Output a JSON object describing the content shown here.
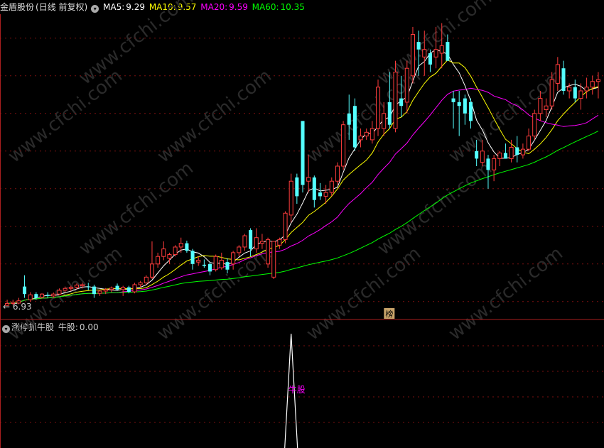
{
  "header": {
    "stock_name": "金盾股份",
    "period": "(日线 前复权)",
    "ma": [
      {
        "label": "MA5:",
        "value": "9.29",
        "color": "#ffffff"
      },
      {
        "label": "MA10:",
        "value": "9.57",
        "color": "#ffff00"
      },
      {
        "label": "MA20:",
        "value": "9.59",
        "color": "#ff00ff"
      },
      {
        "label": "MA60:",
        "value": "10.35",
        "color": "#00ff00"
      }
    ]
  },
  "indicator": {
    "name": "涨停抓牛股",
    "field_label": "牛股:",
    "field_value": "0.00",
    "marker_text": "牛股",
    "marker_color": "#ff00ff"
  },
  "price_annotation": "← 6.93",
  "rank_badge": "榜",
  "watermark": "www.cfchi.com",
  "chart_data": {
    "type": "candlestick",
    "ylim": [
      6.6,
      14.6
    ],
    "colors": {
      "up": "#ff3c3c",
      "down": "#54ffff"
    },
    "candles": [
      {
        "o": 6.9,
        "h": 7.05,
        "l": 6.88,
        "c": 6.95
      },
      {
        "o": 6.95,
        "h": 7.05,
        "l": 6.9,
        "c": 6.98
      },
      {
        "o": 6.96,
        "h": 7.1,
        "l": 6.93,
        "c": 7.02
      },
      {
        "o": 7.4,
        "h": 7.7,
        "l": 7.1,
        "c": 7.2
      },
      {
        "o": 7.05,
        "h": 7.25,
        "l": 7.0,
        "c": 7.18
      },
      {
        "o": 7.2,
        "h": 7.25,
        "l": 7.05,
        "c": 7.1
      },
      {
        "o": 7.12,
        "h": 7.22,
        "l": 7.08,
        "c": 7.2
      },
      {
        "o": 7.18,
        "h": 7.25,
        "l": 7.1,
        "c": 7.15
      },
      {
        "o": 7.15,
        "h": 7.24,
        "l": 7.1,
        "c": 7.2
      },
      {
        "o": 7.2,
        "h": 7.35,
        "l": 7.18,
        "c": 7.3
      },
      {
        "o": 7.3,
        "h": 7.4,
        "l": 7.25,
        "c": 7.35
      },
      {
        "o": 7.35,
        "h": 7.42,
        "l": 7.28,
        "c": 7.38
      },
      {
        "o": 7.38,
        "h": 7.48,
        "l": 7.33,
        "c": 7.44
      },
      {
        "o": 7.42,
        "h": 7.5,
        "l": 7.35,
        "c": 7.45
      },
      {
        "o": 7.4,
        "h": 7.5,
        "l": 7.3,
        "c": 7.38
      },
      {
        "o": 7.4,
        "h": 7.45,
        "l": 7.1,
        "c": 7.2
      },
      {
        "o": 7.22,
        "h": 7.32,
        "l": 7.15,
        "c": 7.28
      },
      {
        "o": 7.28,
        "h": 7.36,
        "l": 7.2,
        "c": 7.32
      },
      {
        "o": 7.32,
        "h": 7.4,
        "l": 7.25,
        "c": 7.36
      },
      {
        "o": 7.42,
        "h": 7.48,
        "l": 7.3,
        "c": 7.32
      },
      {
        "o": 7.32,
        "h": 7.42,
        "l": 7.15,
        "c": 7.38
      },
      {
        "o": 7.38,
        "h": 7.42,
        "l": 7.22,
        "c": 7.26
      },
      {
        "o": 7.26,
        "h": 7.5,
        "l": 7.22,
        "c": 7.45
      },
      {
        "o": 7.45,
        "h": 7.55,
        "l": 7.38,
        "c": 7.5
      },
      {
        "o": 7.5,
        "h": 7.7,
        "l": 7.45,
        "c": 7.65
      },
      {
        "o": 7.65,
        "h": 8.6,
        "l": 7.6,
        "c": 8.0
      },
      {
        "o": 8.0,
        "h": 8.3,
        "l": 7.9,
        "c": 8.2
      },
      {
        "o": 8.2,
        "h": 8.6,
        "l": 8.1,
        "c": 8.4
      },
      {
        "o": 8.15,
        "h": 8.3,
        "l": 8.0,
        "c": 8.25
      },
      {
        "o": 8.25,
        "h": 8.5,
        "l": 8.2,
        "c": 8.45
      },
      {
        "o": 8.45,
        "h": 8.7,
        "l": 8.3,
        "c": 8.55
      },
      {
        "o": 8.55,
        "h": 8.62,
        "l": 8.3,
        "c": 8.35
      },
      {
        "o": 8.35,
        "h": 8.4,
        "l": 7.85,
        "c": 8.0
      },
      {
        "o": 8.05,
        "h": 8.2,
        "l": 7.95,
        "c": 8.1
      },
      {
        "o": 7.98,
        "h": 8.12,
        "l": 7.9,
        "c": 7.95
      },
      {
        "o": 8.0,
        "h": 8.05,
        "l": 7.7,
        "c": 7.8
      },
      {
        "o": 7.85,
        "h": 8.25,
        "l": 7.8,
        "c": 8.2
      },
      {
        "o": 7.9,
        "h": 8.3,
        "l": 7.85,
        "c": 8.1
      },
      {
        "o": 8.05,
        "h": 8.15,
        "l": 7.75,
        "c": 7.85
      },
      {
        "o": 8.0,
        "h": 8.35,
        "l": 7.85,
        "c": 8.3
      },
      {
        "o": 8.3,
        "h": 8.5,
        "l": 8.2,
        "c": 8.45
      },
      {
        "o": 8.45,
        "h": 8.8,
        "l": 8.35,
        "c": 8.75
      },
      {
        "o": 8.9,
        "h": 8.95,
        "l": 8.2,
        "c": 8.4
      },
      {
        "o": 8.4,
        "h": 8.95,
        "l": 8.3,
        "c": 8.7
      },
      {
        "o": 8.55,
        "h": 8.8,
        "l": 8.4,
        "c": 8.6
      },
      {
        "o": 8.0,
        "h": 8.7,
        "l": 7.9,
        "c": 8.65
      },
      {
        "o": 7.65,
        "h": 8.6,
        "l": 7.6,
        "c": 8.6
      },
      {
        "o": 8.5,
        "h": 8.7,
        "l": 8.4,
        "c": 8.65
      },
      {
        "o": 8.65,
        "h": 9.4,
        "l": 8.55,
        "c": 9.35
      },
      {
        "o": 9.3,
        "h": 10.4,
        "l": 9.1,
        "c": 10.2
      },
      {
        "o": 10.3,
        "h": 10.4,
        "l": 9.6,
        "c": 9.8
      },
      {
        "o": 11.8,
        "h": 11.8,
        "l": 9.9,
        "c": 10.1
      },
      {
        "o": 10.2,
        "h": 10.9,
        "l": 9.9,
        "c": 10.3
      },
      {
        "o": 10.3,
        "h": 10.35,
        "l": 9.5,
        "c": 9.7
      },
      {
        "o": 9.9,
        "h": 10.15,
        "l": 9.7,
        "c": 9.8
      },
      {
        "o": 9.8,
        "h": 10.1,
        "l": 9.6,
        "c": 9.9
      },
      {
        "o": 9.9,
        "h": 10.3,
        "l": 9.8,
        "c": 10.2
      },
      {
        "o": 10.2,
        "h": 10.7,
        "l": 10.1,
        "c": 10.6
      },
      {
        "o": 10.6,
        "h": 11.8,
        "l": 10.5,
        "c": 11.7
      },
      {
        "o": 12.0,
        "h": 12.5,
        "l": 11.3,
        "c": 11.7
      },
      {
        "o": 12.2,
        "h": 12.4,
        "l": 11.0,
        "c": 11.1
      },
      {
        "o": 11.3,
        "h": 11.6,
        "l": 11.1,
        "c": 11.4
      },
      {
        "o": 11.4,
        "h": 11.6,
        "l": 11.3,
        "c": 11.5
      },
      {
        "o": 11.3,
        "h": 11.8,
        "l": 11.2,
        "c": 11.6
      },
      {
        "o": 11.6,
        "h": 12.9,
        "l": 11.4,
        "c": 12.7
      },
      {
        "o": 11.6,
        "h": 12.3,
        "l": 11.4,
        "c": 12.0
      },
      {
        "o": 12.3,
        "h": 13.1,
        "l": 11.6,
        "c": 11.7
      },
      {
        "o": 11.6,
        "h": 13.4,
        "l": 11.5,
        "c": 13.1
      },
      {
        "o": 12.4,
        "h": 13.0,
        "l": 11.9,
        "c": 12.2
      },
      {
        "o": 12.3,
        "h": 13.4,
        "l": 12.0,
        "c": 13.2
      },
      {
        "o": 13.0,
        "h": 14.3,
        "l": 12.8,
        "c": 14.1
      },
      {
        "o": 13.9,
        "h": 14.2,
        "l": 13.0,
        "c": 13.7
      },
      {
        "o": 13.5,
        "h": 14.2,
        "l": 13.0,
        "c": 13.7
      },
      {
        "o": 13.6,
        "h": 13.7,
        "l": 13.1,
        "c": 13.3
      },
      {
        "o": 13.5,
        "h": 14.3,
        "l": 13.2,
        "c": 13.7
      },
      {
        "o": 13.6,
        "h": 14.4,
        "l": 13.2,
        "c": 13.8
      },
      {
        "o": 13.9,
        "h": 14.1,
        "l": 13.4,
        "c": 13.4
      },
      {
        "o": 12.4,
        "h": 12.6,
        "l": 11.6,
        "c": 12.3
      },
      {
        "o": 12.3,
        "h": 12.6,
        "l": 11.4,
        "c": 12.2
      },
      {
        "o": 12.4,
        "h": 12.5,
        "l": 11.7,
        "c": 12.0
      },
      {
        "o": 12.3,
        "h": 12.4,
        "l": 11.6,
        "c": 11.8
      },
      {
        "o": 11.0,
        "h": 11.3,
        "l": 10.6,
        "c": 10.8
      },
      {
        "o": 10.7,
        "h": 11.3,
        "l": 10.6,
        "c": 11.0
      },
      {
        "o": 10.8,
        "h": 10.9,
        "l": 10.0,
        "c": 10.5
      },
      {
        "o": 10.5,
        "h": 10.9,
        "l": 10.2,
        "c": 10.8
      },
      {
        "o": 10.8,
        "h": 11.0,
        "l": 10.6,
        "c": 10.95
      },
      {
        "o": 10.95,
        "h": 11.2,
        "l": 10.8,
        "c": 10.8
      },
      {
        "o": 10.8,
        "h": 11.3,
        "l": 10.7,
        "c": 11.1
      },
      {
        "o": 11.1,
        "h": 11.4,
        "l": 10.7,
        "c": 10.9
      },
      {
        "o": 10.9,
        "h": 11.2,
        "l": 10.8,
        "c": 11.05
      },
      {
        "o": 11.05,
        "h": 11.6,
        "l": 11.0,
        "c": 11.4
      },
      {
        "o": 11.4,
        "h": 12.1,
        "l": 11.3,
        "c": 12.0
      },
      {
        "o": 12.0,
        "h": 12.6,
        "l": 11.8,
        "c": 12.4
      },
      {
        "o": 12.1,
        "h": 12.4,
        "l": 11.9,
        "c": 12.2
      },
      {
        "o": 12.2,
        "h": 13.1,
        "l": 12.1,
        "c": 12.9
      },
      {
        "o": 12.8,
        "h": 13.5,
        "l": 12.6,
        "c": 13.3
      },
      {
        "o": 13.2,
        "h": 13.4,
        "l": 12.5,
        "c": 12.6
      },
      {
        "o": 12.6,
        "h": 12.8,
        "l": 12.4,
        "c": 12.7
      },
      {
        "o": 12.7,
        "h": 12.9,
        "l": 12.3,
        "c": 12.4
      },
      {
        "o": 12.4,
        "h": 12.8,
        "l": 12.1,
        "c": 12.6
      },
      {
        "o": 12.6,
        "h": 12.95,
        "l": 12.4,
        "c": 12.7
      },
      {
        "o": 12.7,
        "h": 13.0,
        "l": 12.5,
        "c": 12.85
      },
      {
        "o": 12.85,
        "h": 13.1,
        "l": 12.4,
        "c": 12.9
      }
    ],
    "ma_lines": [
      {
        "name": "MA5",
        "color": "#ffffff",
        "period": 5
      },
      {
        "name": "MA10",
        "color": "#ffff00",
        "period": 10
      },
      {
        "name": "MA20",
        "color": "#ff00ff",
        "period": 20
      },
      {
        "name": "MA60",
        "color": "#00ff00",
        "period": 60
      }
    ],
    "indicator_signal_index": 49
  }
}
